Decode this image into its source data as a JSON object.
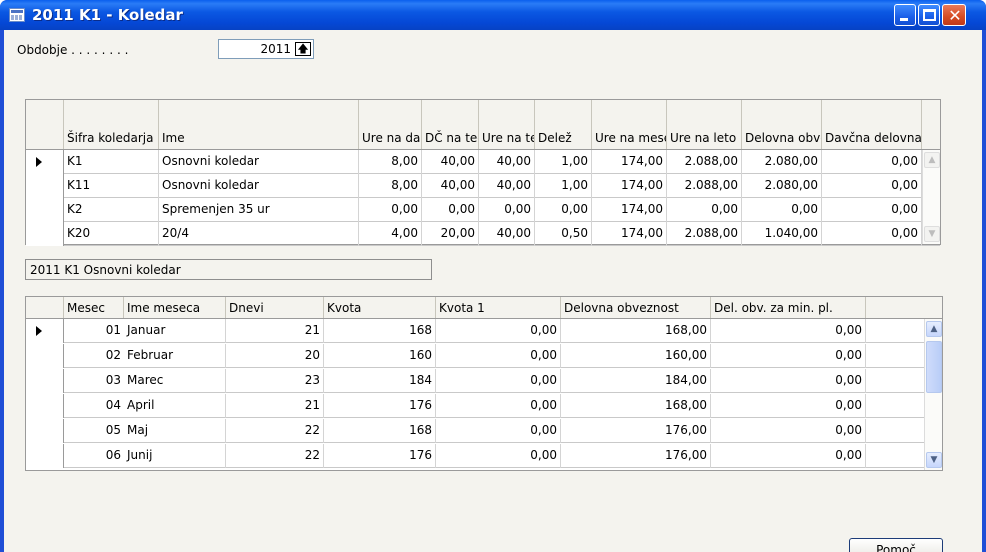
{
  "window": {
    "title": "2011 K1 - Koledar",
    "title_icon": "table-icon",
    "controls": {
      "minimize": "minimize-icon",
      "maximize": "maximize-icon",
      "close": "close-icon",
      "close_glyph": "✕"
    }
  },
  "filter": {
    "label": "Obdobje . . . . . . . .",
    "value": "2011",
    "button_glyph": "🡅"
  },
  "calendar_table": {
    "headers": [
      "Šifra koledarja",
      "Ime",
      "Ure na dan",
      "DČ na teden",
      "Ure na teden",
      "Delež",
      "Ure na mesec",
      "Ure na leto",
      "Delovna obvezn…",
      "Davčna delovna …"
    ],
    "rows": [
      [
        "K1",
        "Osnovni koledar",
        "8,00",
        "40,00",
        "40,00",
        "1,00",
        "174,00",
        "2.088,00",
        "2.080,00",
        "0,00"
      ],
      [
        "K11",
        "Osnovni koledar",
        "8,00",
        "40,00",
        "40,00",
        "1,00",
        "174,00",
        "2.088,00",
        "2.080,00",
        "0,00"
      ],
      [
        "K2",
        "Spremenjen 35 ur",
        "0,00",
        "0,00",
        "0,00",
        "0,00",
        "174,00",
        "0,00",
        "0,00",
        "0,00"
      ],
      [
        "K20",
        "20/4",
        "4,00",
        "20,00",
        "40,00",
        "0,50",
        "174,00",
        "2.088,00",
        "1.040,00",
        "0,00"
      ]
    ],
    "selected_row": 0
  },
  "subtitle": "2011 K1 Osnovni koledar",
  "month_table": {
    "headers": [
      "Mesec",
      "Ime meseca",
      "Dnevi",
      "Kvota",
      "Kvota 1",
      "Delovna obveznost",
      "Del. obv. za min. pl."
    ],
    "rows": [
      [
        "01",
        "Januar",
        "21",
        "168",
        "0,00",
        "168,00",
        "0,00"
      ],
      [
        "02",
        "Februar",
        "20",
        "160",
        "0,00",
        "160,00",
        "0,00"
      ],
      [
        "03",
        "Marec",
        "23",
        "184",
        "0,00",
        "184,00",
        "0,00"
      ],
      [
        "04",
        "April",
        "21",
        "176",
        "0,00",
        "168,00",
        "0,00"
      ],
      [
        "05",
        "Maj",
        "22",
        "168",
        "0,00",
        "176,00",
        "0,00"
      ],
      [
        "06",
        "Junij",
        "22",
        "176",
        "0,00",
        "176,00",
        "0,00"
      ]
    ],
    "selected_row": 0
  },
  "help_button": {
    "label": "Pomoč"
  },
  "colors": {
    "title_bar": "#0548d6",
    "client_bg": "#f4f3ee",
    "grid_bg": "#ffffff"
  }
}
